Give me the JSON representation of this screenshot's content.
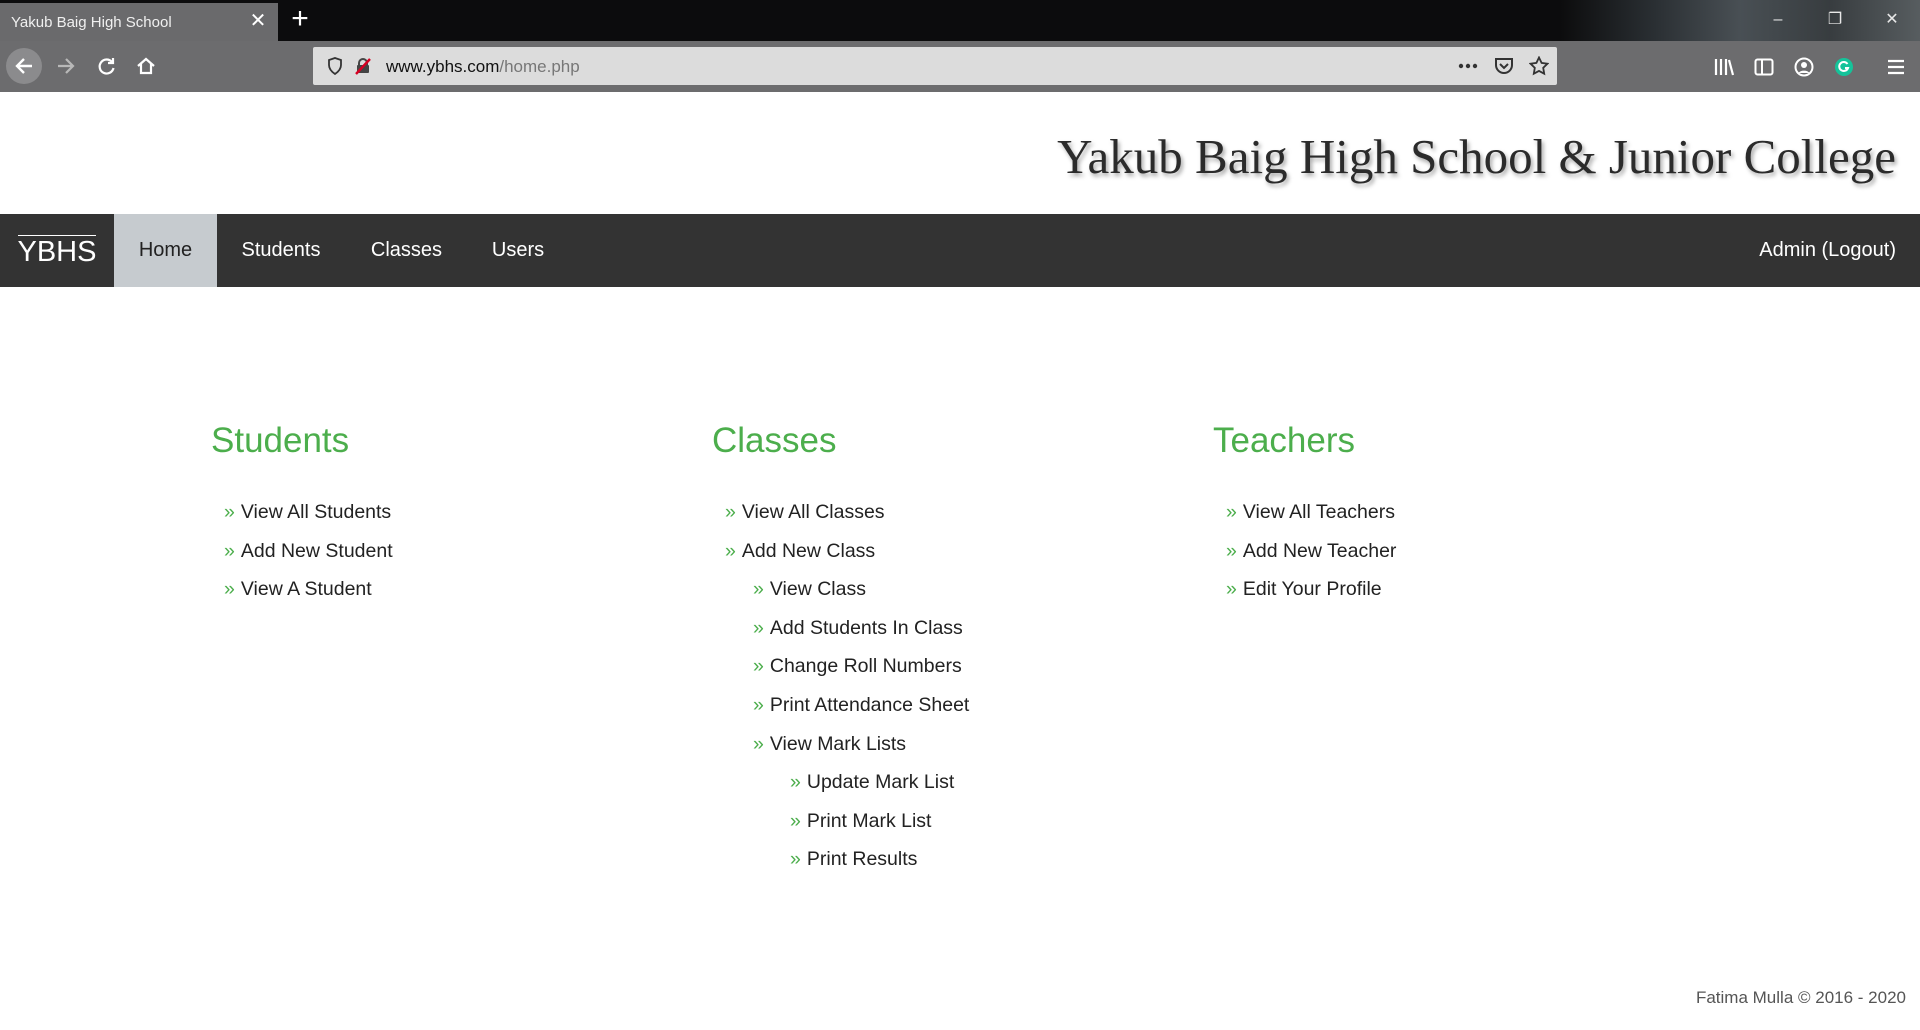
{
  "browser": {
    "tab_title": "Yakub Baig High School",
    "url_domain": "www.ybhs.com",
    "url_path": "/home.php"
  },
  "site": {
    "title": "Yakub Baig High School & Junior College",
    "brand": "YBHS",
    "nav": [
      "Home",
      "Students",
      "Classes",
      "Users"
    ],
    "active_nav": "Home",
    "user_link": "Admin (Logout)"
  },
  "sections": {
    "students": {
      "heading": "Students",
      "items": [
        {
          "label": "View All Students",
          "level": 0
        },
        {
          "label": "Add New Student",
          "level": 0
        },
        {
          "label": "View A Student",
          "level": 0
        }
      ]
    },
    "classes": {
      "heading": "Classes",
      "items": [
        {
          "label": "View All Classes",
          "level": 0
        },
        {
          "label": "Add New Class",
          "level": 0
        },
        {
          "label": "View Class",
          "level": 1
        },
        {
          "label": "Add Students In Class",
          "level": 1
        },
        {
          "label": "Change Roll Numbers",
          "level": 1
        },
        {
          "label": "Print Attendance Sheet",
          "level": 1
        },
        {
          "label": "View Mark Lists",
          "level": 1
        },
        {
          "label": "Update Mark List",
          "level": 2
        },
        {
          "label": "Print Mark List",
          "level": 2
        },
        {
          "label": "Print Results",
          "level": 2
        }
      ]
    },
    "teachers": {
      "heading": "Teachers",
      "items": [
        {
          "label": "View All Teachers",
          "level": 0
        },
        {
          "label": "Add New Teacher",
          "level": 0
        },
        {
          "label": "Edit Your Profile",
          "level": 0
        }
      ]
    }
  },
  "list_bullet": "»",
  "footer": "Fatima Mulla © 2016 - 2020",
  "colors": {
    "accent_green": "#4cae4c",
    "nav_bg": "#333333",
    "nav_active_bg": "#c6cbcf"
  }
}
